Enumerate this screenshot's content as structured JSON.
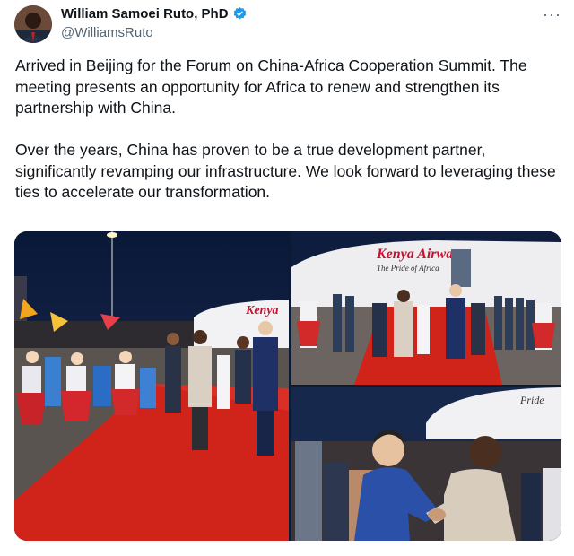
{
  "author": {
    "display_name": "William Samoei Ruto, PhD",
    "handle": "@WilliamsRuto",
    "verified": true,
    "avatar_icon": "profile-photo",
    "verified_icon": "verified-badge-icon"
  },
  "post": {
    "paragraphs": [
      "Arrived in Beijing for the Forum on China-Africa Cooperation Summit. The meeting presents an opportunity for Africa to renew and strengthen its partnership with China.",
      "Over the years, China has proven to be a true development partner, significantly revamping our infrastructure. We look forward to leveraging these ties to accelerate our transformation."
    ]
  },
  "menu": {
    "more_label": "···"
  },
  "media": {
    "count": 3,
    "photos": [
      {
        "name": "arrival-red-carpet-photo",
        "aircraft_text": "Kenya"
      },
      {
        "name": "honor-guard-photo",
        "aircraft_text": "Kenya Airways",
        "aircraft_subtext": "The Pride of Africa"
      },
      {
        "name": "handshake-photo",
        "aircraft_text": "Pride"
      }
    ]
  },
  "colors": {
    "text": "#0f1419",
    "secondary": "#536471",
    "verified": "#1d9bf0",
    "carpet": "#d0241b",
    "kenya_airways_red": "#c8102e"
  }
}
